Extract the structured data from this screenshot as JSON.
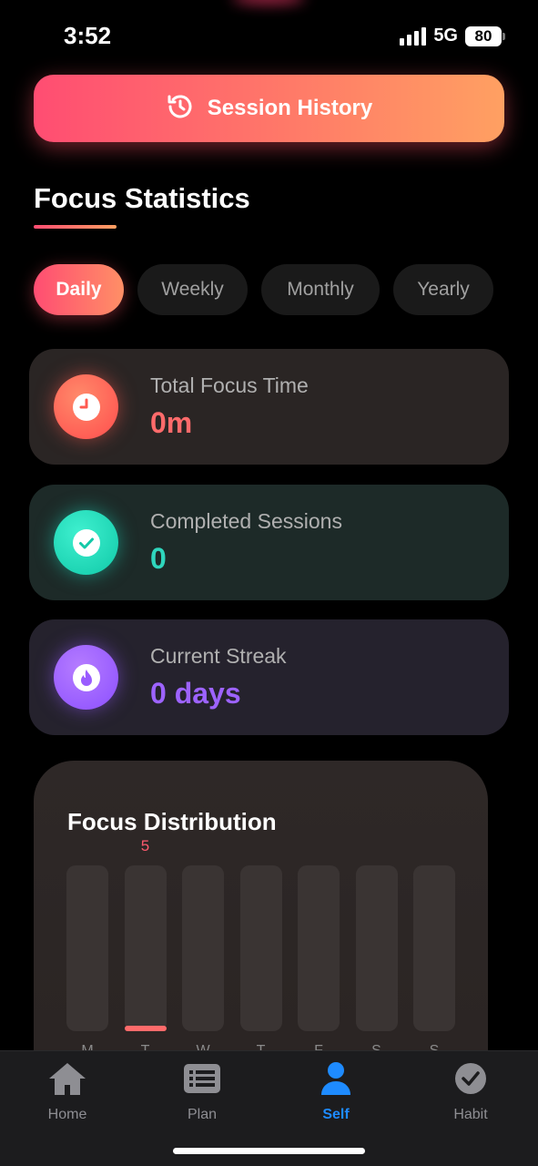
{
  "status_bar": {
    "time": "3:52",
    "network": "5G",
    "battery": "80"
  },
  "header": {
    "session_history_label": "Session History"
  },
  "stats": {
    "title": "Focus Statistics",
    "tabs": [
      {
        "label": "Daily",
        "active": true
      },
      {
        "label": "Weekly",
        "active": false
      },
      {
        "label": "Monthly",
        "active": false
      },
      {
        "label": "Yearly",
        "active": false
      }
    ],
    "cards": {
      "focus_time": {
        "label": "Total Focus Time",
        "value": "0m"
      },
      "sessions": {
        "label": "Completed Sessions",
        "value": "0"
      },
      "streak": {
        "label": "Current Streak",
        "value": "0 days"
      }
    }
  },
  "distribution": {
    "title": "Focus Distribution",
    "days": [
      "M",
      "T",
      "W",
      "T",
      "F",
      "S",
      "S"
    ],
    "highlight_value": "5"
  },
  "chart_data": {
    "type": "bar",
    "title": "Focus Distribution",
    "categories": [
      "M",
      "T",
      "W",
      "T",
      "F",
      "S",
      "S"
    ],
    "values": [
      0,
      5,
      0,
      0,
      0,
      0,
      0
    ],
    "color": "#ff6b6b"
  },
  "tabbar": {
    "items": [
      {
        "label": "Home",
        "icon": "home-icon",
        "active": false
      },
      {
        "label": "Plan",
        "icon": "list-icon",
        "active": false
      },
      {
        "label": "Self",
        "icon": "person-icon",
        "active": true
      },
      {
        "label": "Habit",
        "icon": "check-circle-icon",
        "active": false
      }
    ]
  },
  "colors": {
    "accent": "#ff4d72",
    "active_tab": "#1e8bff"
  }
}
